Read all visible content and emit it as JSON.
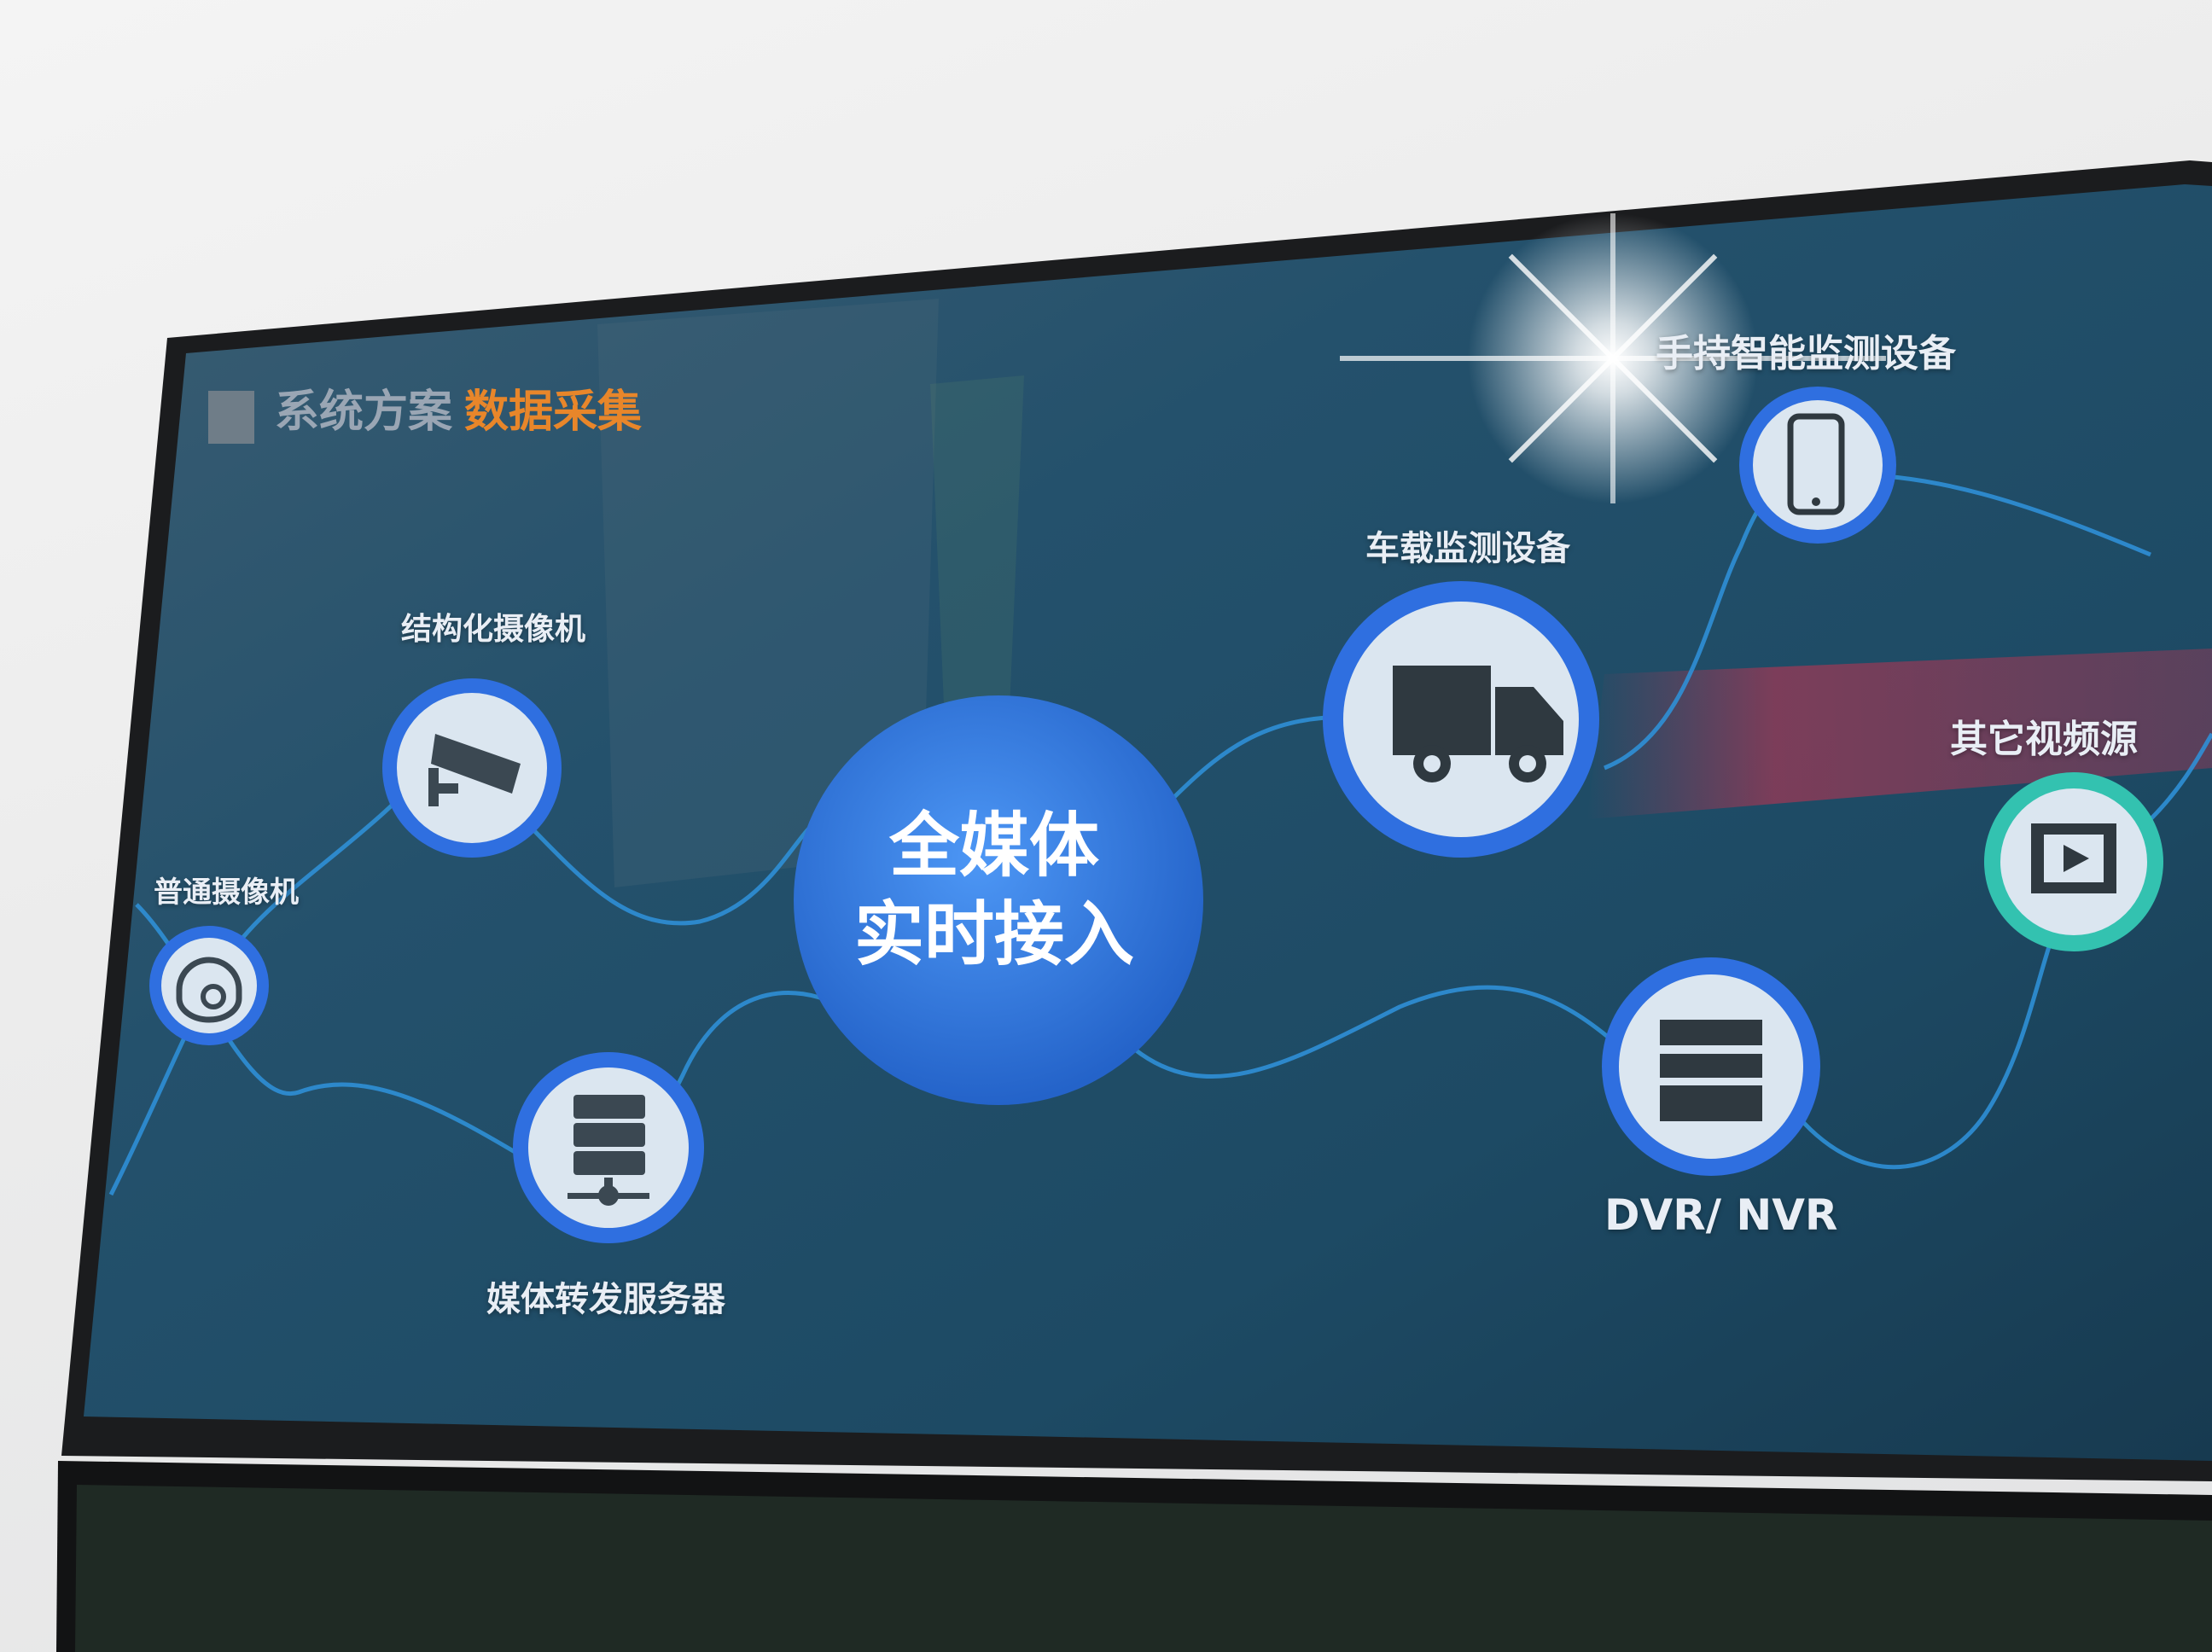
{
  "slide": {
    "title_prefix": "系统方案",
    "title_accent": "数据采集",
    "center_line1": "全媒体",
    "center_line2": "实时接入"
  },
  "nodes": {
    "ordinary_camera": "普通摄像机",
    "structured_camera": "结构化摄像机",
    "media_server": "媒体转发服务器",
    "vehicle_device": "车载监测设备",
    "handheld_device": "手持智能监测设备",
    "other_video": "其它视频源",
    "dvr_nvr": "DVR/ NVR"
  },
  "colors": {
    "accent_orange": "#e8862a",
    "node_ring_blue": "#2f6fe0",
    "node_ring_teal": "#33c2b0",
    "center_blue": "#2f7ee8",
    "screen_bg": "#1c4560"
  },
  "icons": {
    "ordinary_camera": "dome-camera-icon",
    "structured_camera": "cctv-camera-icon",
    "media_server": "server-icon",
    "vehicle_device": "truck-icon",
    "handheld_device": "phone-icon",
    "other_video": "video-player-icon",
    "dvr_nvr": "recorder-icon"
  }
}
